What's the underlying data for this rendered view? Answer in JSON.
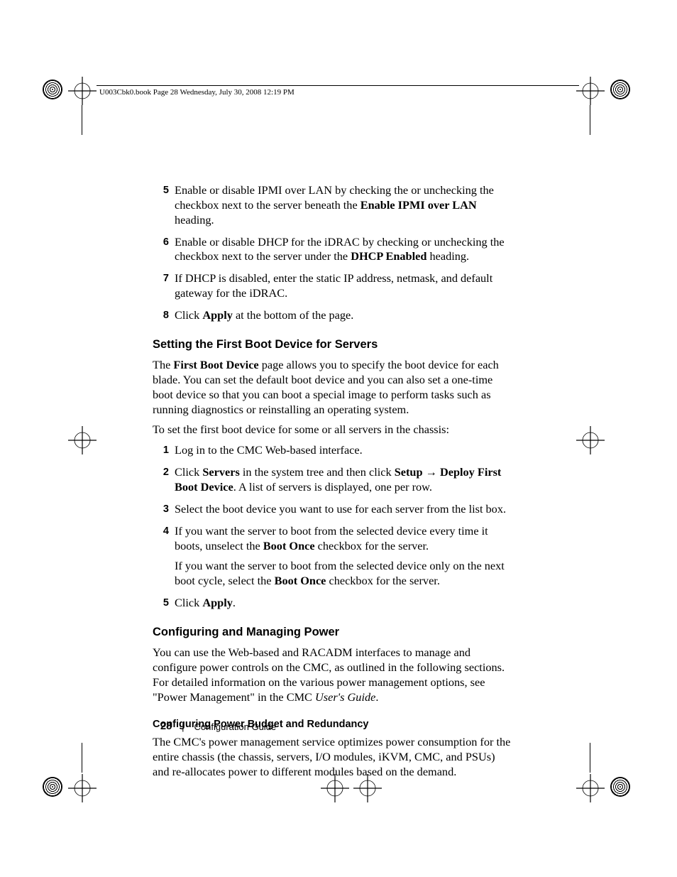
{
  "header": {
    "running": "U003Cbk0.book  Page 28  Wednesday, July 30, 2008  12:19 PM"
  },
  "steps_top": [
    {
      "n": "5",
      "html": "Enable or disable IPMI over LAN by checking the or unchecking the checkbox next to the server beneath the <span class='b'>Enable IPMI over LAN</span> heading."
    },
    {
      "n": "6",
      "html": "Enable or disable DHCP for the iDRAC by checking or unchecking the checkbox next to the server under the <span class='b'>DHCP Enabled</span> heading."
    },
    {
      "n": "7",
      "html": "If DHCP is disabled, enter the static IP address, netmask, and default gateway for the iDRAC."
    },
    {
      "n": "8",
      "html": "Click <span class='b'>Apply</span> at the bottom of the page."
    }
  ],
  "sec1": {
    "title": "Setting the First Boot Device for Servers",
    "intro": "The <span class='b'>First Boot Device</span> page allows you to specify the boot device for each blade. You can set the default boot device and you can also set a one-time boot device so that you can boot a special image to perform tasks such as running diagnostics or reinstalling an operating system.",
    "lead": "To set the first boot device for some or all servers in the chassis:",
    "steps": [
      {
        "n": "1",
        "html": "Log in to the CMC Web-based interface."
      },
      {
        "n": "2",
        "html": "Click <span class='b'>Servers</span> in the system tree and then click <span class='b'>Setup</span> <span class='arrow'>→</span> <span class='b'>Deploy First Boot Device</span>. A list of servers is displayed, one per row."
      },
      {
        "n": "3",
        "html": "Select the boot device you want to use for each server from the list box."
      },
      {
        "n": "4",
        "html": "If you want the server to boot from the selected device every time it boots, unselect the <span class='b'>Boot Once</span> checkbox for the server.<div class='para-after'>If you want the server to boot from the selected device only on the next boot cycle, select the <span class='b'>Boot Once</span> checkbox for the server.</div>"
      },
      {
        "n": "5",
        "html": "Click <span class='b'>Apply</span>."
      }
    ]
  },
  "sec2": {
    "title": "Configuring and Managing Power",
    "intro": "You can use the Web-based and RACADM interfaces to manage and configure power controls on the CMC, as outlined in the following sections. For detailed information on the various power management options, see \"Power Management\" in the CMC <span class='i'>User's Guide</span>."
  },
  "sub1": {
    "title": "Configuring Power Budget and Redundancy",
    "body": "The CMC's power management service optimizes power consumption for the entire chassis (the chassis, servers, I/O modules, iKVM, CMC, and PSUs) and re-allocates power to different modules based on the demand."
  },
  "footer": {
    "page": "28",
    "label": "Configuration Guide"
  }
}
